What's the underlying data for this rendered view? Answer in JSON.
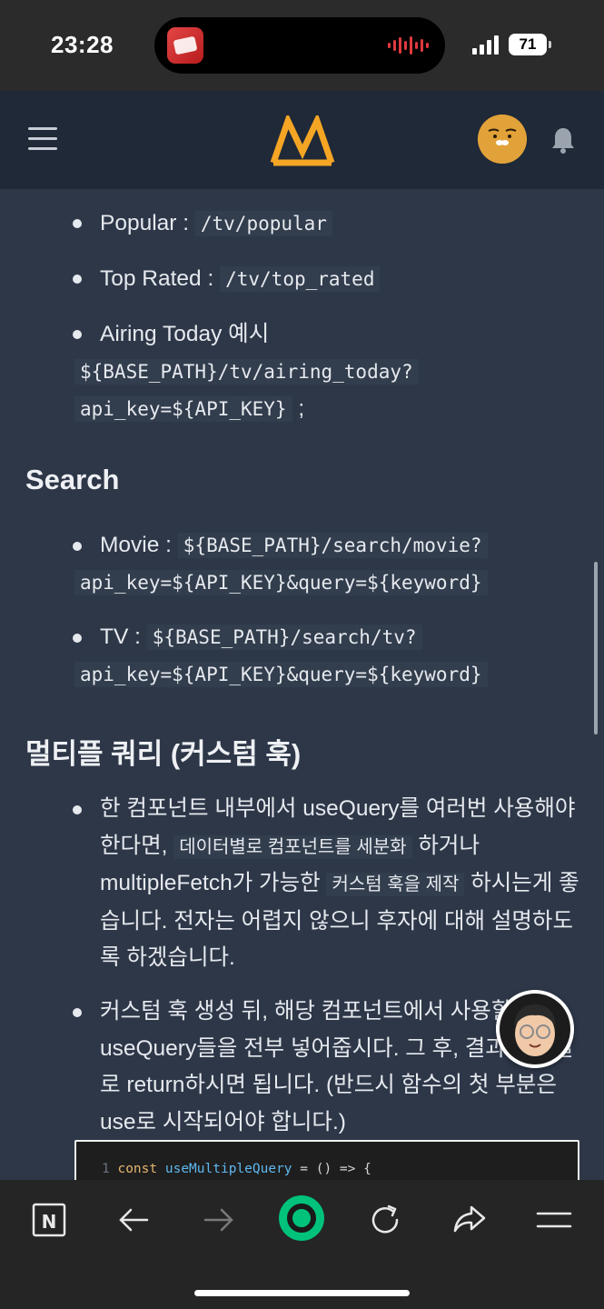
{
  "status_bar": {
    "time": "23:28",
    "battery": "71"
  },
  "header": {
    "menu_icon": "hamburger-menu-icon",
    "logo": "site-logo",
    "avatar": "ryan-avatar",
    "bell_icon": "bell-icon"
  },
  "colors": {
    "accent": "#f5a524",
    "page_bg": "#2d3748",
    "header_bg": "#1f2937",
    "bottom_bar_bg": "#252525",
    "nav_green": "#00c27a"
  },
  "content": {
    "tv_items": [
      {
        "label": "Popular : ",
        "code": "/tv/popular"
      },
      {
        "label": "Top Rated : ",
        "code": "/tv/top_rated"
      },
      {
        "label": "Airing Today 예시",
        "code": "${BASE_PATH}/tv/airing_today?",
        "code2": "api_key=${API_KEY}",
        "suffix": " ;"
      }
    ],
    "search_heading": "Search",
    "search_items": [
      {
        "label": "Movie : ",
        "code": "${BASE_PATH}/search/movie?",
        "code2": "api_key=${API_KEY}&query=${keyword}"
      },
      {
        "label": "TV : ",
        "code": "${BASE_PATH}/search/tv?",
        "code2": "api_key=${API_KEY}&query=${keyword}"
      }
    ],
    "multi_heading": "멀티플 쿼리 (커스텀 훅)",
    "para1": {
      "a": "한 컴포넌트 내부에서 useQuery를 여러번 사용해야 한다면, ",
      "code_a": "데이터별로 컴포넌트를 세분화",
      "b": " 하거나 multipleFetch가 가능한 ",
      "code_b": "커스텀 훅을 제작",
      "c": " 하시는게 좋습니다. 전자는 어렵지 않으니 후자에 대해 설명하도록 하겠습니다."
    },
    "para2": "커스텀 훅 생성 뒤, 해당 컴포넌트에서 사용할 useQuery들을 전부 넣어줍시다. 그 후, 결과를 배열로 return하시면 됩니다. (반드시 함수의 첫 부분은 use로 시작되어야 합니다.)",
    "code_block": {
      "line_no": "1",
      "kw": "const",
      "fn": "useMultipleQuery",
      "rest": " = () => {"
    }
  },
  "bottom_nav": {
    "items": [
      "notion-icon",
      "back-arrow-icon",
      "forward-arrow-icon",
      "naver-home-icon",
      "reload-icon",
      "share-icon",
      "menu-icon"
    ]
  }
}
